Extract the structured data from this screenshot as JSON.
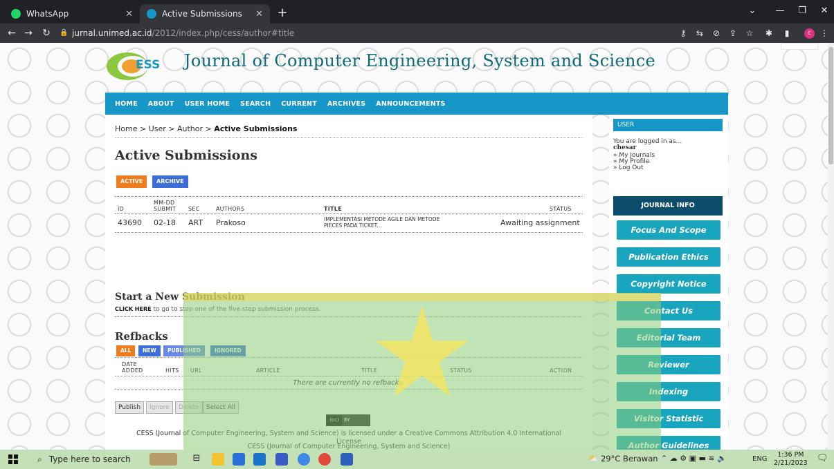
{
  "browser": {
    "tabs": [
      {
        "title": "WhatsApp",
        "favicon_color": "#25d366"
      },
      {
        "title": "Active Submissions",
        "favicon_color": "#1796c8"
      }
    ],
    "url_host": "jurnal.unimed.ac.id",
    "url_path": "/2012/index.php/cess/author#title",
    "profile_initial": "c"
  },
  "banner": {
    "logo_text": "ESS",
    "title": "Journal of Computer Engineering, System and Science"
  },
  "nav": [
    "HOME",
    "ABOUT",
    "USER HOME",
    "SEARCH",
    "CURRENT",
    "ARCHIVES",
    "ANNOUNCEMENTS"
  ],
  "breadcrumb": {
    "home": "Home",
    "user": "User",
    "author": "Author",
    "current": "Active Submissions",
    "sep": " > "
  },
  "page_title": "Active Submissions",
  "submission_tabs": {
    "active": "ACTIVE",
    "archive": "ARCHIVE"
  },
  "submissions": {
    "headers": {
      "id": "ID",
      "date_top": "MM-DD",
      "date_bottom": "SUBMIT",
      "sec": "SEC",
      "authors": "AUTHORS",
      "title": "TITLE",
      "status": "STATUS"
    },
    "rows": [
      {
        "id": "43690",
        "date": "02-18",
        "sec": "ART",
        "authors": "Prakoso",
        "title_line1": "IMPLEMENTASI METODE AGILE DAN METODE",
        "title_line2": "PIECES PADA TICKET...",
        "status": "Awaiting assignment"
      }
    ]
  },
  "new_submission": {
    "heading": "Start a New Submission",
    "link": "CLICK HERE",
    "text": " to go to step one of the five-step submission process."
  },
  "refbacks": {
    "heading": "Refbacks",
    "filters": {
      "all": "ALL",
      "new": "NEW",
      "published": "PUBLISHED",
      "ignored": "IGNORED"
    },
    "headers": {
      "date_top": "DATE",
      "date_bottom": "ADDED",
      "hits": "HITS",
      "url": "URL",
      "article": "ARTICLE",
      "title": "TITLE",
      "status": "STATUS",
      "action": "ACTION"
    },
    "empty": "There are currently no refbacks.",
    "actions": {
      "publish": "Publish",
      "ignore": "Ignore",
      "delete": "Delete",
      "select_all": "Select All"
    }
  },
  "footer": {
    "name": "CESS (Journal of Computer Engineering, System and Science)",
    "cc_badge_left": "(cc)",
    "cc_badge_right": "BY",
    "license_line1": "CESS (Journal of Computer Engineering, System and Science) is licensed under a Creative Commons Attribution 4.0 International",
    "license_line2": "License"
  },
  "sidebar": {
    "user_heading": "USER",
    "logged_in_as": "You are logged in as...",
    "username": "chesar",
    "links": [
      "» My Journals",
      "» My Profile",
      "» Log Out"
    ],
    "journal_info": "JOURNAL INFO",
    "journal_links": [
      "Focus And Scope",
      "Publication Ethics",
      "Copyright Notice",
      "Contact Us",
      "Editorial Team",
      "Reviewer",
      "Indexing",
      "Visitor Statistic",
      "Author Guidelines"
    ]
  },
  "taskbar": {
    "search_placeholder": "Type here to search",
    "weather": "29°C Berawan",
    "lang": "ENG",
    "time": "1:36 PM",
    "date": "2/21/2023"
  }
}
